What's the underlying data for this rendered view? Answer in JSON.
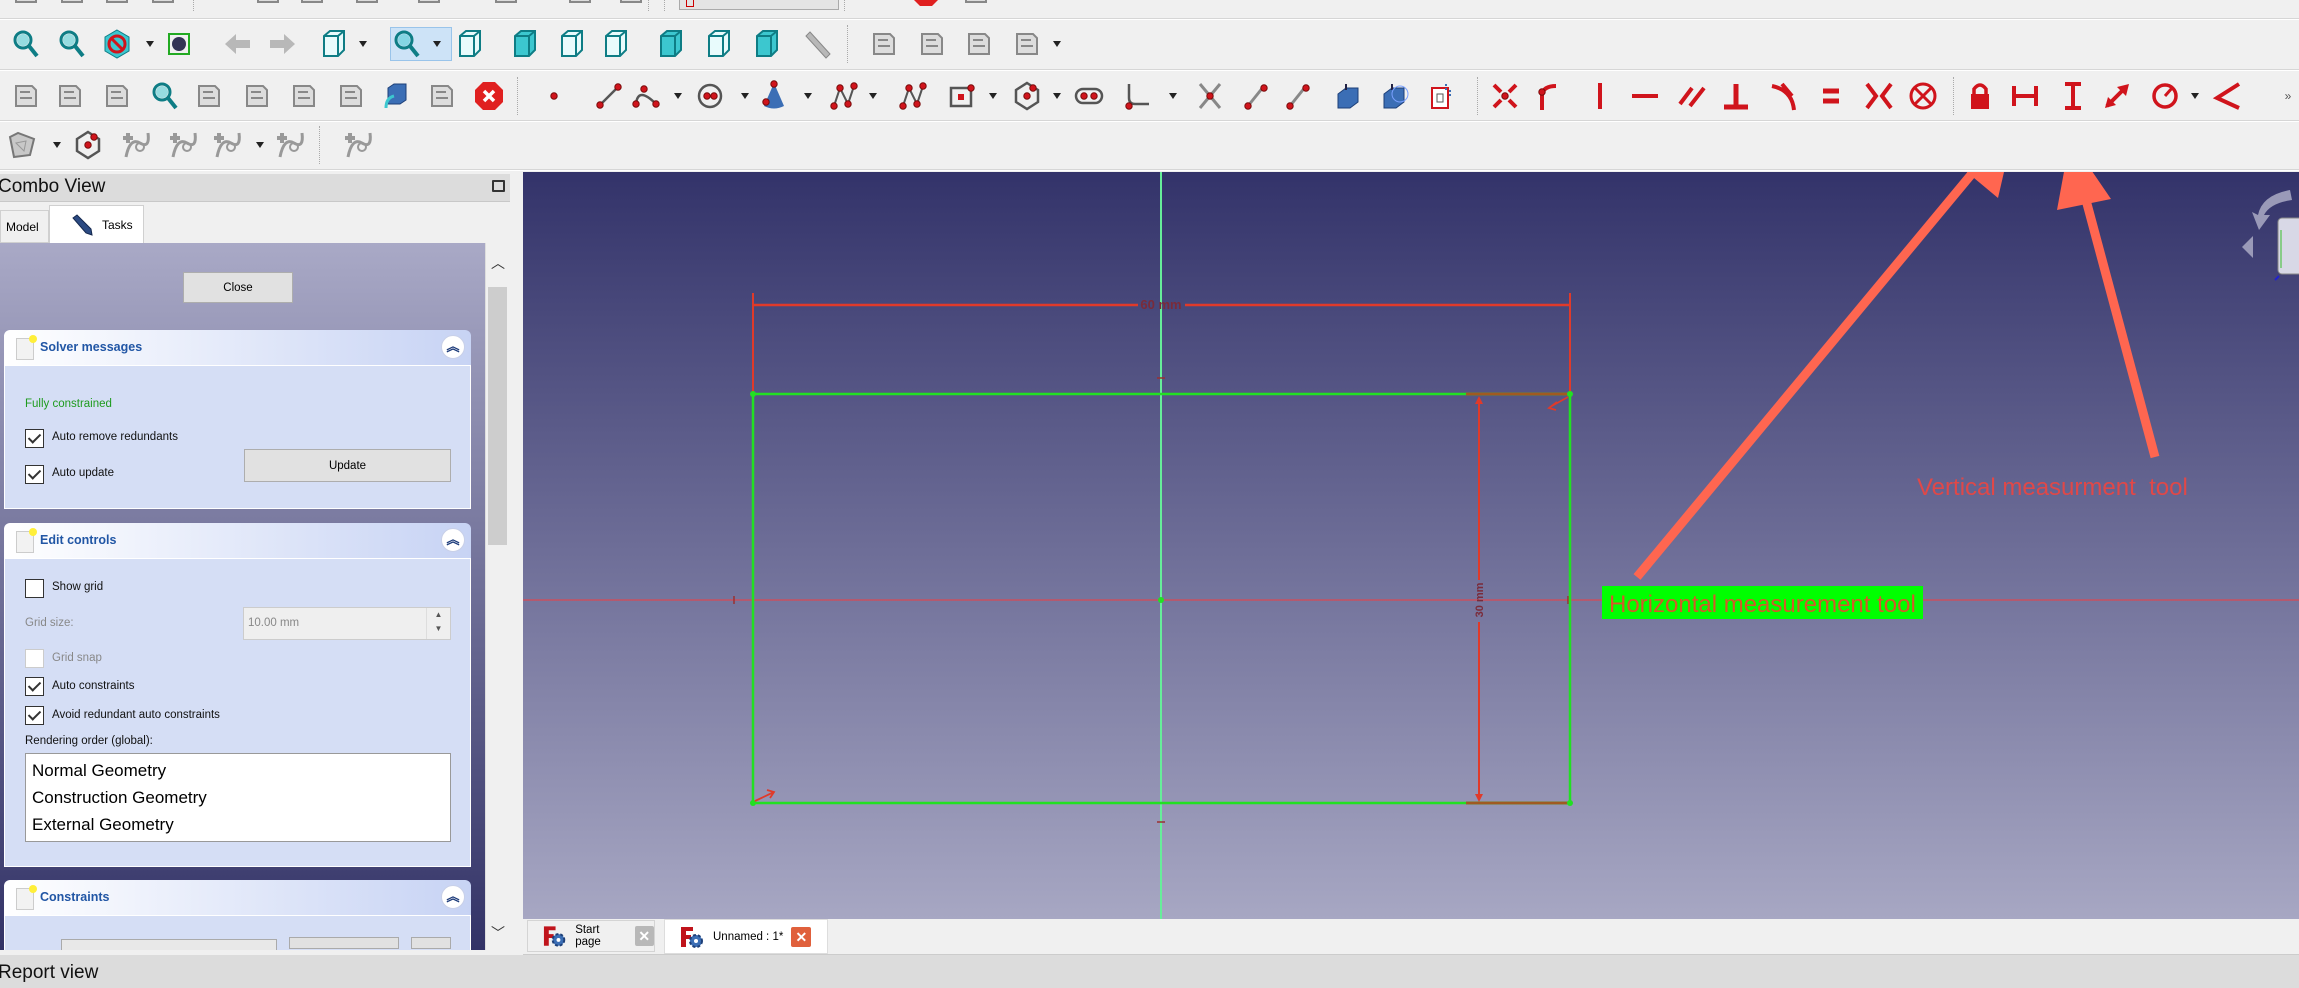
{
  "toolbars": {
    "row0": [
      "new-icon",
      "open-icon",
      "save-icon",
      "save-as-icon",
      "cut-icon",
      "copy-icon",
      "paste-icon",
      "undo-icon",
      "redo-icon",
      "refresh-icon",
      "macro-icon",
      "whats-this-icon",
      "workbench-selector",
      "record-macro-icon",
      "stop-macro-icon",
      "macros-icon",
      "execute-macro-icon"
    ],
    "row1": [
      "fit-all-icon",
      "fit-selection-icon",
      "draw-style-icon",
      "dropdown",
      "bounding-box-icon",
      "back-icon",
      "forward-icon",
      "sync-view-icon",
      "dropdown",
      "zoom-sync-icon",
      "dropdown",
      "isometric-view-icon",
      "front-view-icon",
      "top-view-icon",
      "right-view-icon",
      "rear-view-icon",
      "bottom-view-icon",
      "left-view-icon",
      "measure-distance-icon",
      "create-part-icon",
      "create-group-icon",
      "make-link-icon",
      "link-actions-icon",
      "dropdown"
    ],
    "row2": [
      "view-sketch-icon",
      "attach-sketch-icon",
      "leave-sketch-icon",
      "view-section-icon",
      "reorient-sketch-icon",
      "validate-sketch-icon",
      "merge-sketches-icon",
      "mirror-sketch-icon",
      "map-sketch-icon",
      "rotate-sketch-icon",
      "close-sketch-icon",
      "point-icon",
      "line-icon",
      "arc-icon",
      "dropdown",
      "circle-icon",
      "dropdown",
      "conic-icon",
      "dropdown",
      "bspline-icon",
      "dropdown",
      "polyline-icon",
      "rectangle-icon",
      "dropdown",
      "polygon-icon",
      "dropdown",
      "slot-icon",
      "fillet-icon",
      "dropdown",
      "trim-icon",
      "extend-icon",
      "split-icon",
      "external-geometry-icon",
      "carbon-copy-icon",
      "toggle-construction-icon",
      "coincident-constraint-icon",
      "point-on-object-constraint-icon",
      "vertical-constraint-icon",
      "horizontal-constraint-icon",
      "parallel-constraint-icon",
      "perpendicular-constraint-icon",
      "tangent-constraint-icon",
      "equal-constraint-icon",
      "symmetric-constraint-icon",
      "block-constraint-icon",
      "lock-constraint-icon",
      "horizontal-distance-constraint-icon",
      "vertical-distance-constraint-icon",
      "distance-constraint-icon",
      "radius-constraint-icon",
      "dropdown",
      "angle-constraint-icon",
      "toolbar-overflow"
    ],
    "row3": [
      "bspline-degree-icon",
      "dropdown",
      "bspline-polygon-icon",
      "increase-knot-icon",
      "decrease-knot-icon",
      "knot-multiplicity-icon",
      "dropdown",
      "bspline-info-icon",
      "virtual-space-icon"
    ]
  },
  "combo": {
    "title": "Combo View",
    "tabs": [
      {
        "label": "Model"
      },
      {
        "label": "Tasks"
      }
    ]
  },
  "tasks": {
    "close_label": "Close",
    "solver": {
      "title": "Solver messages",
      "status": "Fully constrained",
      "status_color": "#1e9b1e",
      "auto_remove": {
        "label": "Auto remove redundants",
        "checked": true
      },
      "auto_update": {
        "label": "Auto update",
        "checked": true
      },
      "update_label": "Update"
    },
    "edit": {
      "title": "Edit controls",
      "show_grid": {
        "label": "Show grid",
        "checked": false
      },
      "grid_size_label": "Grid size:",
      "grid_size_value": "10.00 mm",
      "grid_snap": {
        "label": "Grid snap",
        "checked": false
      },
      "auto_constraints": {
        "label": "Auto constraints",
        "checked": true
      },
      "avoid_redundant": {
        "label": "Avoid redundant auto constraints",
        "checked": true
      },
      "render_order_label": "Rendering order (global):",
      "render_order": [
        "Normal Geometry",
        "Construction Geometry",
        "External Geometry"
      ]
    },
    "constraints": {
      "title": "Constraints"
    }
  },
  "viewport": {
    "horizontal_dimension": "60 mm",
    "vertical_dimension": "30 mm",
    "annotation_horizontal": "Horizontal measurement tool",
    "annotation_vertical": "Vertical measurment  tool",
    "colors": {
      "geometry": "#22e022",
      "constraint": "#e03a2a",
      "annotation_arrow": "#ff6650",
      "label_bg": "#00ff00"
    }
  },
  "doc_tabs": [
    {
      "label": "Start page",
      "active": false
    },
    {
      "label": "Unnamed : 1*",
      "active": true
    }
  ],
  "report_view": {
    "title": "Report view"
  }
}
